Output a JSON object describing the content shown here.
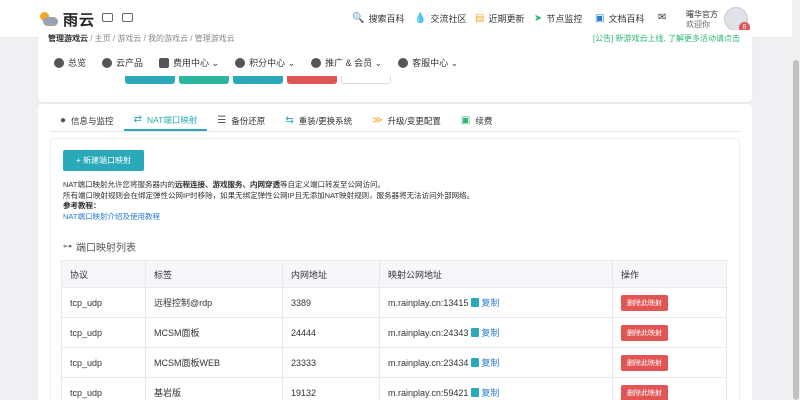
{
  "brand": {
    "name": "雨云"
  },
  "nav": [
    {
      "icon": "🔍",
      "icon_name": "search-icon",
      "label": "搜索百科"
    },
    {
      "icon": "💧",
      "icon_name": "drop-icon",
      "label": "交流社区"
    },
    {
      "icon": "▤",
      "icon_name": "updates-icon",
      "label": "近期更新"
    },
    {
      "icon": "➤",
      "icon_name": "monitor-icon",
      "label": "节点监控"
    },
    {
      "icon": "▣",
      "icon_name": "docs-icon",
      "label": "文档百科"
    },
    {
      "icon": "✉",
      "icon_name": "mail-icon",
      "label": ""
    }
  ],
  "user": {
    "name": "曙华官方",
    "greeting": "欢迎你",
    "badge": "8"
  },
  "breadcrumb": {
    "title": "管理游戏云",
    "path": "/ 主页 / 游戏云 / 我的游戏云 / 管理游戏云"
  },
  "notice": "[公告] 新游戏云上线, 了解更多活动请点击",
  "menu": [
    {
      "label": "总览"
    },
    {
      "label": "云产品"
    },
    {
      "label": "费用中心 ⌄"
    },
    {
      "label": "积分中心 ⌄"
    },
    {
      "label": "推广 & 会员 ⌄"
    },
    {
      "label": "客服中心 ⌄"
    }
  ],
  "tabs": [
    {
      "icon": "●",
      "label": "信息与监控",
      "active": false
    },
    {
      "icon": "⇄",
      "label": "NAT端口映射",
      "active": true
    },
    {
      "icon": "☰",
      "label": "备份还原",
      "active": false
    },
    {
      "icon": "⇆",
      "label": "重装/更换系统",
      "active": false
    },
    {
      "icon": "≫",
      "label": "升级/变更配置",
      "active": false
    },
    {
      "icon": "▣",
      "label": "续费",
      "active": false
    }
  ],
  "new_button": "+ 新建端口映射",
  "desc": {
    "line1_pre": "NAT端口映射允许您将服务器内的",
    "line1_bold": "远程连接、游戏服务、内网穿透",
    "line1_post": "等自定义端口转发至公网访问。",
    "line2": "所有端口映射规则会在绑定弹性公网IP时移除，如果无绑定弹性公网IP且无添加NAT映射规则，服务器将无法访问外部网络。",
    "line3": "参考教程：",
    "link": "NAT端口映射介绍及使用教程"
  },
  "section_title": "端口映射列表",
  "table": {
    "headers": [
      "协议",
      "标签",
      "内网地址",
      "映射公网地址",
      "操作"
    ],
    "rows": [
      {
        "protocol": "tcp_udp",
        "label": "远程控制@rdp",
        "internal": "3389",
        "public": "m.rainplay.cn:13415"
      },
      {
        "protocol": "tcp_udp",
        "label": "MCSM面板",
        "internal": "24444",
        "public": "m.rainplay.cn:24343"
      },
      {
        "protocol": "tcp_udp",
        "label": "MCSM面板WEB",
        "internal": "23333",
        "public": "m.rainplay.cn:23434"
      },
      {
        "protocol": "tcp_udp",
        "label": "基岩版",
        "internal": "19132",
        "public": "m.rainplay.cn:59421"
      }
    ],
    "copy_label": "复制",
    "delete_label": "删除此映射"
  },
  "colors": {
    "accent": "#2aa9b8",
    "danger": "#e25555",
    "link": "#2a7ad5"
  }
}
